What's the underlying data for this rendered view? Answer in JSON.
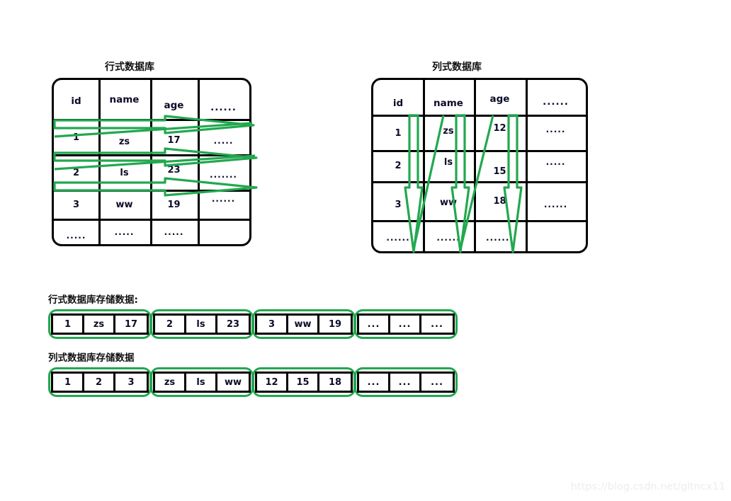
{
  "tables": {
    "row_store": {
      "title": "行式数据库",
      "headers": [
        "id",
        "name",
        "age",
        "......"
      ],
      "rows": [
        [
          "1",
          "zs",
          "17",
          "....."
        ],
        [
          "2",
          "ls",
          "23",
          "......."
        ],
        [
          "3",
          "ww",
          "19",
          "......"
        ],
        [
          ".....",
          ".....",
          ".....",
          ""
        ]
      ]
    },
    "col_store": {
      "title": "列式数据库",
      "headers": [
        "id",
        "name",
        "age",
        "......"
      ],
      "rows": [
        [
          "1",
          "zs",
          "12",
          "....."
        ],
        [
          "2",
          "ls",
          "15",
          "....."
        ],
        [
          "3",
          "ww",
          "18",
          "......"
        ],
        [
          "......",
          "......",
          ".......",
          ""
        ]
      ]
    }
  },
  "storage": {
    "row_store": {
      "label": "行式数据库存储数据:",
      "groups": [
        [
          "1",
          "zs",
          "17"
        ],
        [
          "2",
          "ls",
          "23"
        ],
        [
          "3",
          "ww",
          "19"
        ],
        [
          "...",
          "...",
          "..."
        ]
      ]
    },
    "col_store": {
      "label": "列式数据库存储数据",
      "groups": [
        [
          "1",
          "2",
          "3"
        ],
        [
          "zs",
          "ls",
          "ww"
        ],
        [
          "12",
          "15",
          "18"
        ],
        [
          "...",
          "...",
          "..."
        ]
      ]
    }
  },
  "annotations": {
    "arrow_color": "#22A84F",
    "row_store_arrow_direction": "horizontal-right",
    "col_store_arrow_direction": "vertical-down"
  },
  "watermark": "https://blog.csdn.net/gltncx11"
}
